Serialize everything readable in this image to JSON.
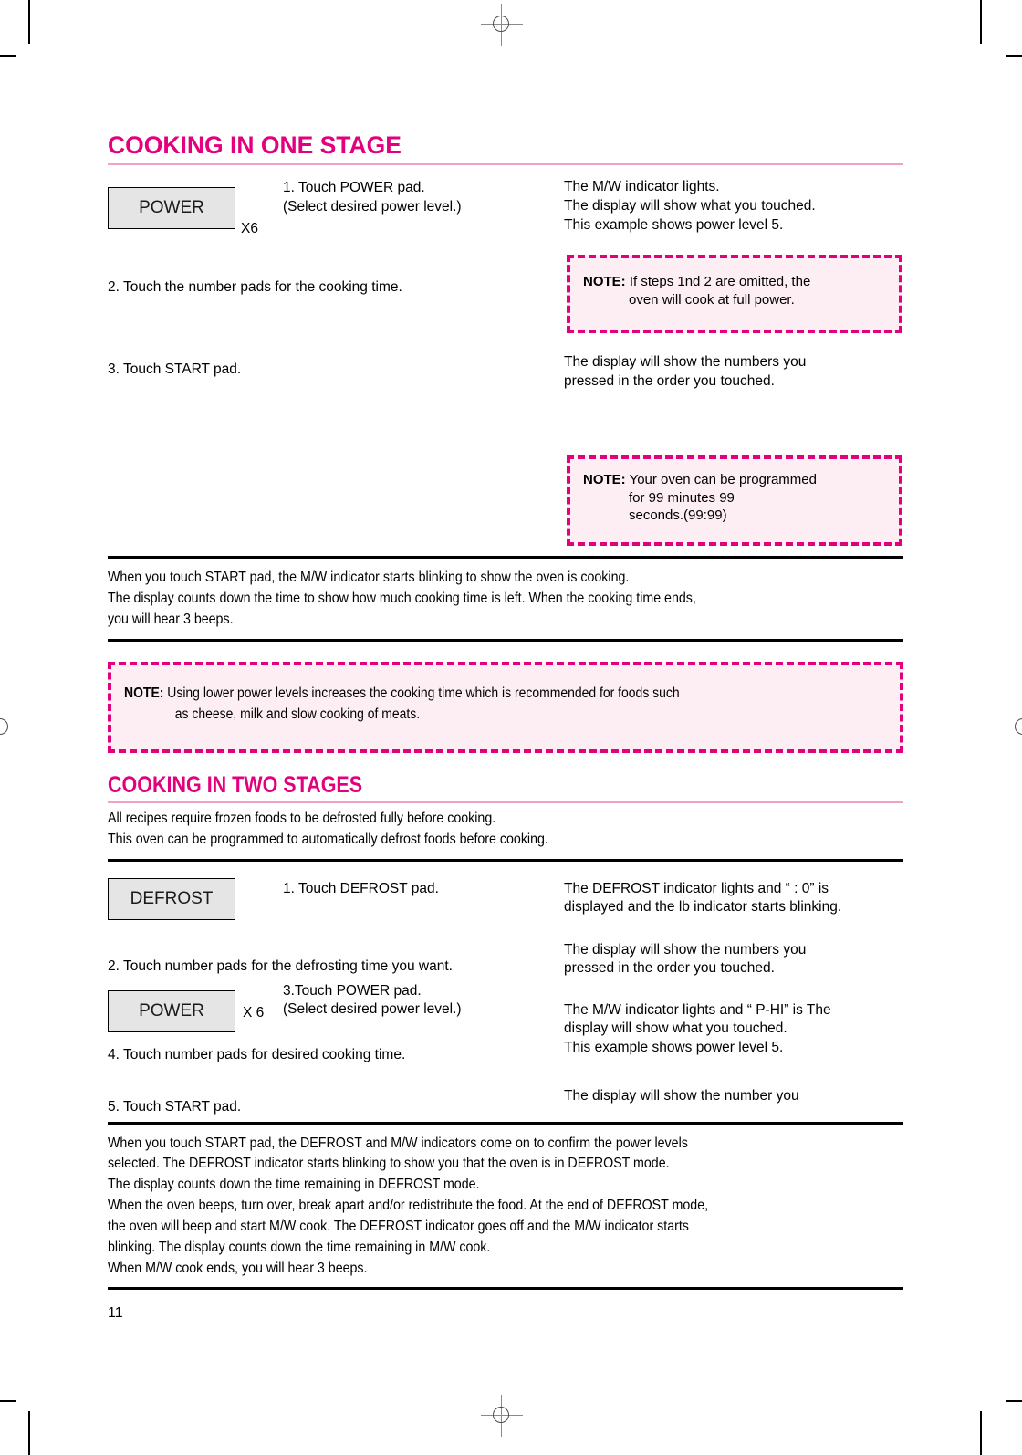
{
  "page": {
    "number": "11"
  },
  "section_one": {
    "heading": "COOKING IN ONE STAGE",
    "pad_label": "POWER",
    "pad_multiplier": "X6",
    "step1_line1": "1. Touch POWER pad.",
    "step1_line2": "(Select desired power level.)",
    "step2": "2. Touch the number pads for the cooking time.",
    "step3": "3. Touch START pad.",
    "result1_line1": "The M/W indicator lights.",
    "result1_line2": "The display will show what you touched.",
    "result1_line3": "This example shows power level 5.",
    "note1_label": "NOTE:",
    "note1_line1": " If steps 1nd 2 are omitted, the",
    "note1_line2": "oven will cook at full power.",
    "result2_line1": "The display will show the numbers you",
    "result2_line2": "pressed in the order you touched.",
    "note2_label": "NOTE:",
    "note2_line1": " Your oven can be programmed",
    "note2_line2": "for 99 minutes 99",
    "note2_line3": "seconds.(99:99)",
    "summary_line1": "When you touch START pad, the M/W indicator starts blinking to show the oven is cooking.",
    "summary_line2": "The display counts down the time to show how much cooking time is left. When the cooking time ends,",
    "summary_line3": "you will hear 3 beeps.",
    "note3_label": "NOTE:",
    "note3_line1": " Using lower power levels increases the cooking time which is recommended for foods such",
    "note3_line2": "as cheese, milk and slow cooking of meats."
  },
  "section_two": {
    "heading": "COOKING IN TWO STAGES",
    "intro_line1": "All recipes require frozen foods to be defrosted fully before cooking.",
    "intro_line2": "This oven can be programmed to automatically defrost foods before cooking.",
    "defrost_pad_label": "DEFROST",
    "power_pad_label": "POWER",
    "power_pad_multiplier": "X 6",
    "step1": "1. Touch DEFROST pad.",
    "step2": "2. Touch number pads for the defrosting time you want.",
    "step3_line1": "3.Touch POWER pad.",
    "step3_line2": "(Select desired power level.)",
    "step4": "4. Touch number pads for desired cooking time.",
    "step5": "5. Touch START pad.",
    "result1_line1": "The DEFROST indicator lights and “ : 0” is",
    "result1_line2": "displayed and the lb indicator starts blinking.",
    "result2_line1": "The display will show the numbers you",
    "result2_line2": "pressed in the order you touched.",
    "result3_line1": "The M/W indicator lights and “ P-HI” is The",
    "result3_line2": "display will show what you touched.",
    "result3_line3": "This example shows power level 5.",
    "result4_line1": "The display will show the number you",
    "summary_line1": "When you touch START pad, the DEFROST and M/W indicators come on to confirm the power levels",
    "summary_line2": "selected. The DEFROST indicator starts blinking to show you that the oven is in DEFROST mode.",
    "summary_line3": "The display counts down the time remaining in DEFROST mode.",
    "summary_line4": "When the oven beeps, turn over, break apart and/or redistribute the food. At the end of DEFROST mode,",
    "summary_line5": "the oven will beep and start M/W cook. The DEFROST indicator goes off and the M/W indicator starts",
    "summary_line6": "blinking. The display counts down the time remaining in M/W cook.",
    "summary_line7": "When M/W cook ends, you will hear 3 beeps."
  },
  "colors": {
    "accent_pink": "#e3007f",
    "note_fill": "#fdeef4",
    "rule_pink": "#f2a0c8",
    "pad_fill": "#e5e5e5"
  }
}
